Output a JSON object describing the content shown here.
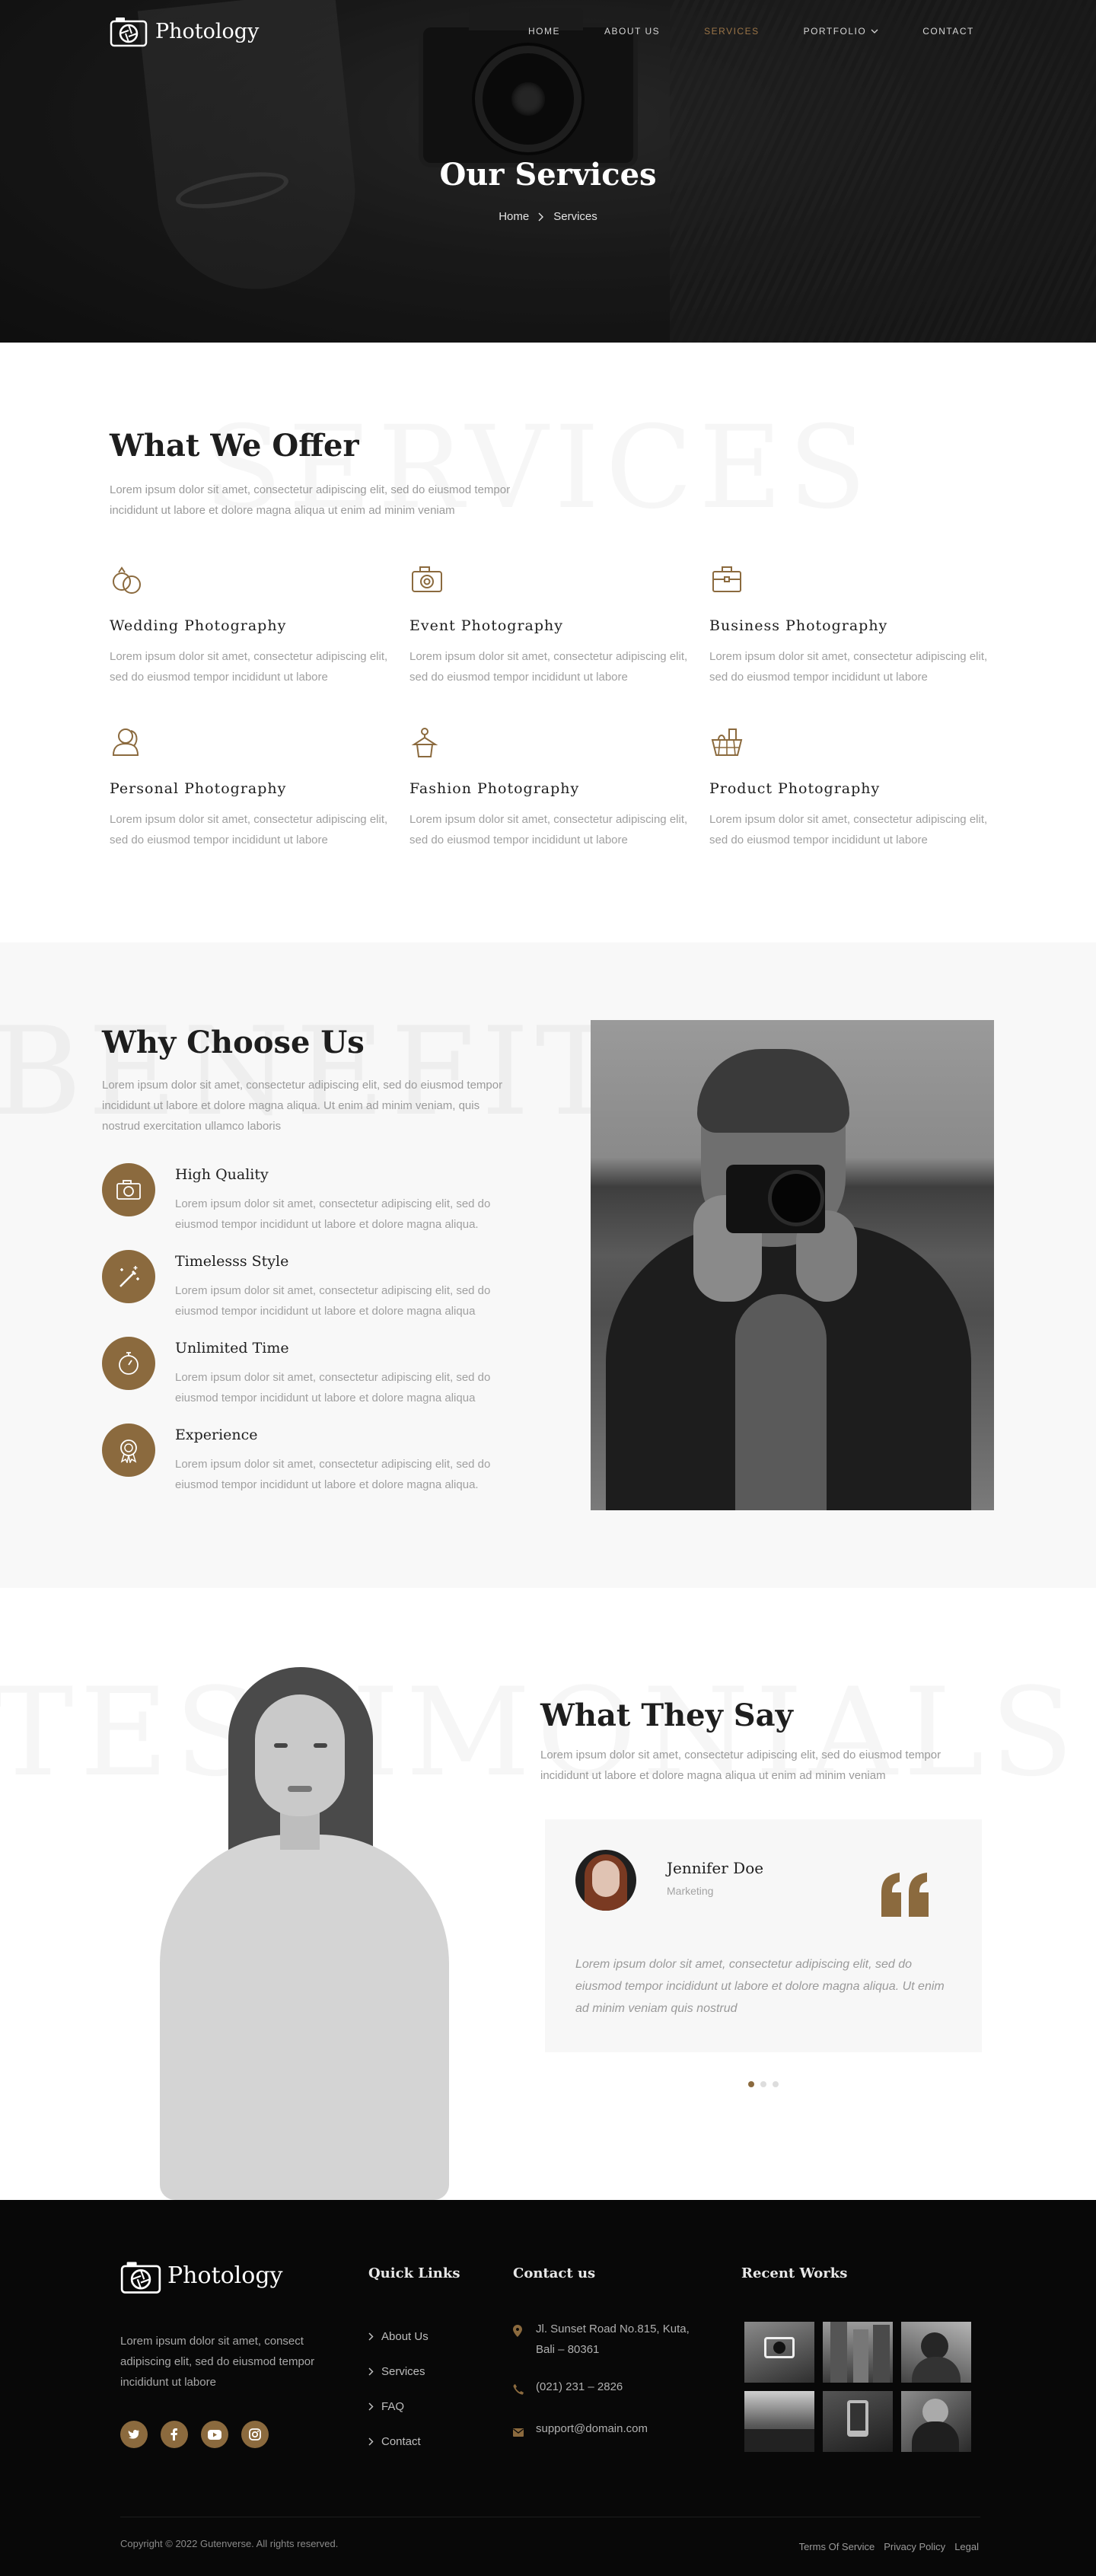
{
  "brand": {
    "name": "Photology",
    "accent": "#8b6a3e",
    "nav_active": "#9a7447"
  },
  "nav": {
    "items": [
      {
        "label": "HOME",
        "active": false,
        "has_dropdown": false
      },
      {
        "label": "ABOUT US",
        "active": false,
        "has_dropdown": false
      },
      {
        "label": "SERVICES",
        "active": true,
        "has_dropdown": false
      },
      {
        "label": "PORTFOLIO",
        "active": false,
        "has_dropdown": true
      },
      {
        "label": "CONTACT",
        "active": false,
        "has_dropdown": false
      }
    ]
  },
  "hero": {
    "title": "Our Services",
    "breadcrumb": [
      "Home",
      "Services"
    ]
  },
  "offer": {
    "watermark": "SERVICES",
    "title": "What We Offer",
    "desc": "Lorem ipsum dolor sit amet, consectetur adipiscing elit, sed do eiusmod tempor incididunt ut labore et dolore magna aliqua ut enim ad minim veniam",
    "services": [
      {
        "icon": "rings-icon",
        "title": "Wedding Photography",
        "text": "Lorem ipsum dolor sit amet, consectetur adipiscing elit, sed do eiusmod tempor incididunt ut labore"
      },
      {
        "icon": "camera-icon",
        "title": "Event Photography",
        "text": "Lorem ipsum dolor sit amet, consectetur adipiscing elit, sed do eiusmod tempor incididunt ut labore"
      },
      {
        "icon": "briefcase-icon",
        "title": "Business Photography",
        "text": "Lorem ipsum dolor sit amet, consectetur adipiscing elit, sed do eiusmod tempor incididunt ut labore"
      },
      {
        "icon": "person-icon",
        "title": "Personal Photography",
        "text": "Lorem ipsum dolor sit amet, consectetur adipiscing elit, sed do eiusmod tempor incididunt ut labore"
      },
      {
        "icon": "hanger-shirt-icon",
        "title": "Fashion Photography",
        "text": "Lorem ipsum dolor sit amet, consectetur adipiscing elit, sed do eiusmod tempor incididunt ut labore"
      },
      {
        "icon": "basket-icon",
        "title": "Product Photography",
        "text": "Lorem ipsum dolor sit amet, consectetur adipiscing elit, sed do eiusmod tempor incididunt ut labore"
      }
    ]
  },
  "why": {
    "watermark": "BENEFITS",
    "title": "Why Choose Us",
    "desc": "Lorem ipsum dolor sit amet, consectetur adipiscing elit, sed do eiusmod tempor incididunt ut labore et dolore magna aliqua. Ut enim ad minim veniam, quis nostrud exercitation ullamco laboris",
    "features": [
      {
        "icon": "photo-camera-icon",
        "title": "High Quality",
        "text": "Lorem ipsum dolor sit amet, consectetur adipiscing elit, sed do eiusmod tempor incididunt ut labore et dolore magna aliqua."
      },
      {
        "icon": "magic-wand-icon",
        "title": "Timelesss Style",
        "text": "Lorem ipsum dolor sit amet, consectetur adipiscing elit, sed do eiusmod tempor incididunt ut labore et dolore magna aliqua"
      },
      {
        "icon": "stopwatch-icon",
        "title": "Unlimited Time",
        "text": "Lorem ipsum dolor sit amet, consectetur adipiscing elit, sed do eiusmod tempor incididunt ut labore et dolore magna aliqua"
      },
      {
        "icon": "award-badge-icon",
        "title": "Experience",
        "text": "Lorem ipsum dolor sit amet, consectetur adipiscing elit, sed do eiusmod tempor incididunt ut labore et dolore magna aliqua."
      }
    ]
  },
  "testimonials": {
    "watermark": "TESTIMONIALS",
    "title": "What They Say",
    "desc": "Lorem ipsum dolor sit amet, consectetur adipiscing elit, sed do eiusmod tempor incididunt ut labore et dolore magna aliqua ut enim ad minim veniam",
    "card": {
      "name": "Jennifer Doe",
      "role": "Marketing",
      "quote": "Lorem ipsum dolor sit amet, consectetur adipiscing elit, sed do eiusmod tempor incididunt ut labore et dolore magna aliqua. Ut enim ad minim veniam quis nostrud"
    },
    "dots": [
      true,
      false,
      false
    ]
  },
  "footer": {
    "about": "Lorem ipsum dolor sit amet, consect adipiscing elit, sed do eiusmod tempor incididunt ut labore",
    "socials": [
      "twitter-icon",
      "facebook-icon",
      "youtube-icon",
      "instagram-icon"
    ],
    "quick_links_title": "Quick Links",
    "quick_links": [
      "About Us",
      "Services",
      "FAQ",
      "Contact"
    ],
    "contact_title": "Contact us",
    "address": "Jl. Sunset Road No.815, Kuta, Bali – 80361",
    "phone": "(021) 231 – 2826",
    "email": "support@domain.com",
    "works_title": "Recent Works",
    "copyright": "Copyright © 2022 Gutenverse. All rights reserved.",
    "legal": [
      "Terms Of Service",
      "Privacy Policy",
      "Legal"
    ]
  }
}
